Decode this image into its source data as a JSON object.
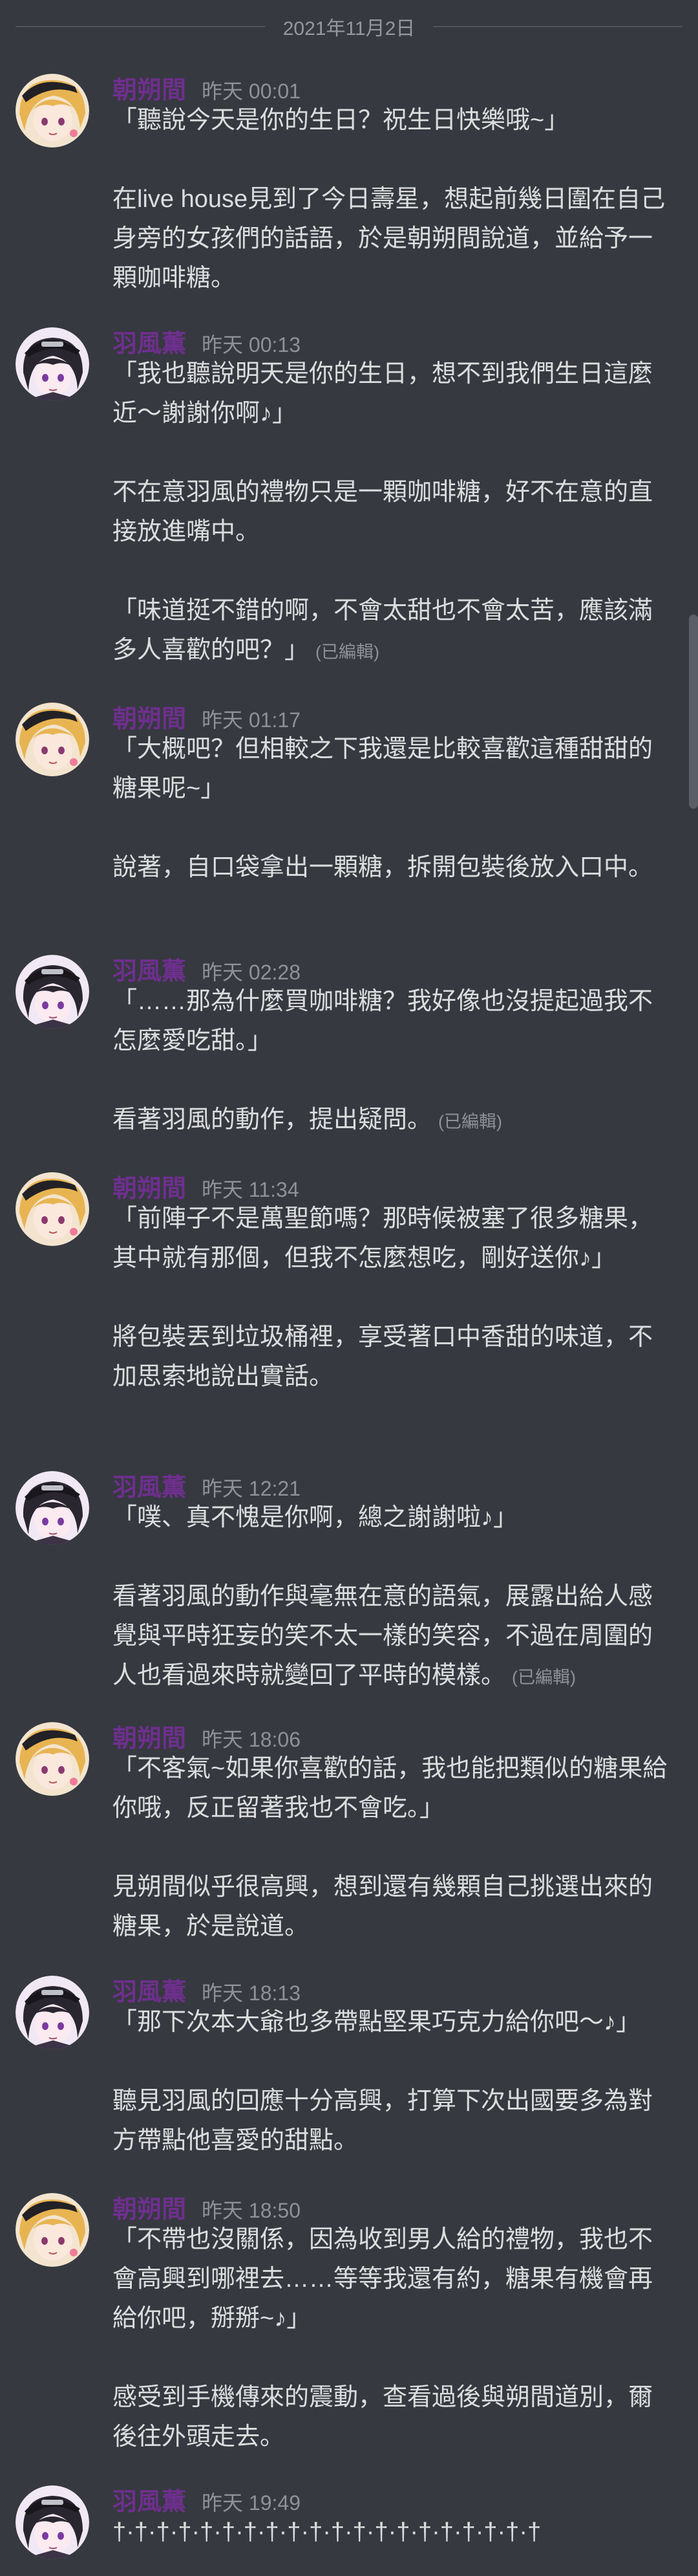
{
  "date_divider": "2021年11月2日",
  "users": {
    "a": "朝朔間",
    "b": "羽風薫"
  },
  "colors": {
    "background": "#36393f",
    "name": "#6e2f8e",
    "text": "#dcddde",
    "muted": "#8e9297"
  },
  "edited_label": "(已編輯)",
  "messages": [
    {
      "avatar": "blonde-character-avatar",
      "name": "朝朔間",
      "time": "昨天 00:01",
      "paragraphs": [
        "「聽說今天是你的生日？祝生日快樂哦~」",
        "在live house見到了今日壽星，想起前幾日圍在自己身旁的女孩們的話語，於是朝朔間說道，並給予一顆咖啡糖。"
      ]
    },
    {
      "avatar": "dark-haired-character-avatar",
      "name": "羽風薫",
      "time": "昨天 00:13",
      "paragraphs": [
        "「我也聽說明天是你的生日，想不到我們生日這麼近～謝謝你啊♪」",
        "不在意羽風的禮物只是一顆咖啡糖，好不在意的直接放進嘴中。",
        "「味道挺不錯的啊，不會太甜也不會太苦，應該滿多人喜歡的吧？」"
      ],
      "edited": true
    },
    {
      "avatar": "blonde-character-avatar",
      "name": "朝朔間",
      "time": "昨天 01:17",
      "paragraphs": [
        "「大概吧？但相較之下我還是比較喜歡這種甜甜的糖果呢~」",
        "說著，自口袋拿出一顆糖，拆開包裝後放入口中。"
      ]
    },
    {
      "avatar": "dark-haired-character-avatar",
      "name": "羽風薫",
      "time": "昨天 02:28",
      "paragraphs": [
        "「……那為什麼買咖啡糖？我好像也沒提起過我不怎麼愛吃甜。」",
        "看著羽風的動作，提出疑問。"
      ],
      "edited": true
    },
    {
      "avatar": "blonde-character-avatar",
      "name": "朝朔間",
      "time": "昨天 11:34",
      "paragraphs": [
        "「前陣子不是萬聖節嗎？那時候被塞了很多糖果，其中就有那個，但我不怎麼想吃，剛好送你♪」",
        "將包裝丟到垃圾桶裡，享受著口中香甜的味道，不加思索地說出實話。"
      ]
    },
    {
      "avatar": "dark-haired-character-avatar",
      "name": "羽風薫",
      "time": "昨天 12:21",
      "paragraphs": [
        "「噗、真不愧是你啊，總之謝謝啦♪」",
        "看著羽風的動作與毫無在意的語氣，展露出給人感覺與平時狂妄的笑不太一樣的笑容，不過在周圍的人也看過來時就變回了平時的模樣。"
      ],
      "edited": true
    },
    {
      "avatar": "blonde-character-avatar",
      "name": "朝朔間",
      "time": "昨天 18:06",
      "paragraphs": [
        "「不客氣~如果你喜歡的話，我也能把類似的糖果給你哦，反正留著我也不會吃。」",
        "見朔間似乎很高興，想到還有幾顆自己挑選出來的糖果，於是說道。"
      ]
    },
    {
      "avatar": "dark-haired-character-avatar",
      "name": "羽風薫",
      "time": "昨天 18:13",
      "paragraphs": [
        "「那下次本大爺也多帶點堅果巧克力給你吧～♪」",
        "聽見羽風的回應十分高興，打算下次出國要多為對方帶點他喜愛的甜點。"
      ]
    },
    {
      "avatar": "blonde-character-avatar",
      "name": "朝朔間",
      "time": "昨天 18:50",
      "paragraphs": [
        "「不帶也沒關係，因為收到男人給的禮物，我也不會高興到哪裡去……等等我還有約，糖果有機會再給你吧，掰掰~♪」",
        "感受到手機傳來的震動，查看過後與朔間道別，爾後往外頭走去。"
      ]
    },
    {
      "avatar": "dark-haired-character-avatar",
      "name": "羽風薫",
      "time": "昨天 19:49",
      "paragraphs": [
        "†·†·†·†·†·†·†·†·†·†·†·†·†·†·†·†·†·†·†·†"
      ]
    }
  ]
}
